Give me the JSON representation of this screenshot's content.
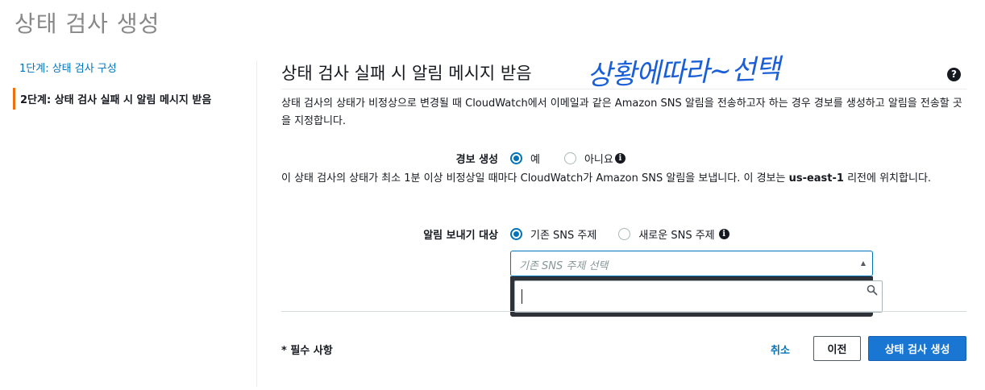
{
  "page": {
    "title": "상태 검사 생성"
  },
  "steps": [
    {
      "label": "1단계: 상태 검사 구성"
    },
    {
      "label": "2단계: 상태 검사 실패 시 알림 메시지 받음"
    }
  ],
  "section": {
    "title": "상태 검사 실패 시 알림 메시지 받음",
    "annotation": "상황에따라~선택",
    "help_icon": "?",
    "description": "상태 검사의 상태가 비정상으로 변경될 때 CloudWatch에서 이메일과 같은 Amazon SNS 알림을 전송하고자 하는 경우 경보를 생성하고 알림을 전송할 곳을 지정합니다."
  },
  "alarm": {
    "label": "경보 생성",
    "options": [
      {
        "label": "예",
        "checked": true
      },
      {
        "label": "아니요",
        "checked": false
      }
    ],
    "info_icon": "i",
    "note_before": "이 상태 검사의 상태가 최소 1분 이상 비정상일 때마다 CloudWatch가 Amazon SNS 알림을 보냅니다. 이 경보는 ",
    "note_region": "us-east-1",
    "note_after": " 리전에 위치합니다."
  },
  "notify": {
    "label": "알림 보내기 대상",
    "options": [
      {
        "label": "기존 SNS 주제",
        "checked": true
      },
      {
        "label": "새로운 SNS 주제",
        "checked": false
      }
    ],
    "info_icon": "i",
    "select_placeholder": "기존 SNS 주제 선택",
    "caret": "▲",
    "search_value": ""
  },
  "footer": {
    "required_note": "* 필수 사항",
    "cancel_label": "취소",
    "prev_label": "이전",
    "create_label": "상태 검사 생성"
  },
  "colors": {
    "accent": "#0073bb",
    "step_marker": "#ec7211",
    "primary_button": "#1976d2",
    "annotation": "#1a5fd6"
  }
}
